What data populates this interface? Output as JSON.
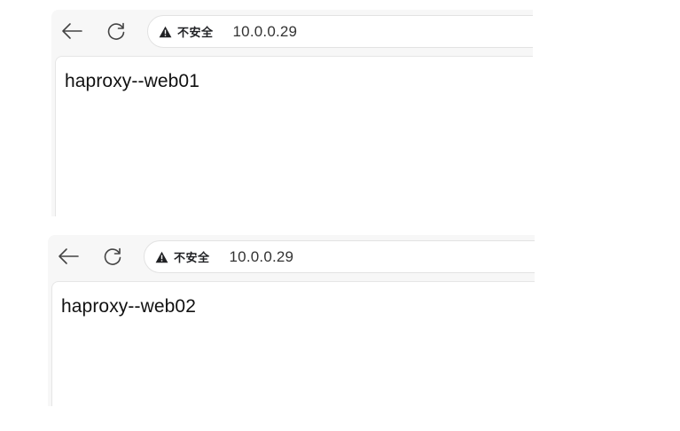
{
  "windows": [
    {
      "security_label": "不安全",
      "url": "10.0.0.29",
      "page_text": "haproxy--web01"
    },
    {
      "security_label": "不安全",
      "url": "10.0.0.29",
      "page_text": "haproxy--web02"
    }
  ],
  "icons": {
    "back": "back-arrow-icon",
    "reload": "reload-icon",
    "security": "warning-triangle-icon"
  },
  "colors": {
    "toolbar_background": "#f7f7f7",
    "page_background": "#ffffff",
    "icon_color": "#444444"
  }
}
